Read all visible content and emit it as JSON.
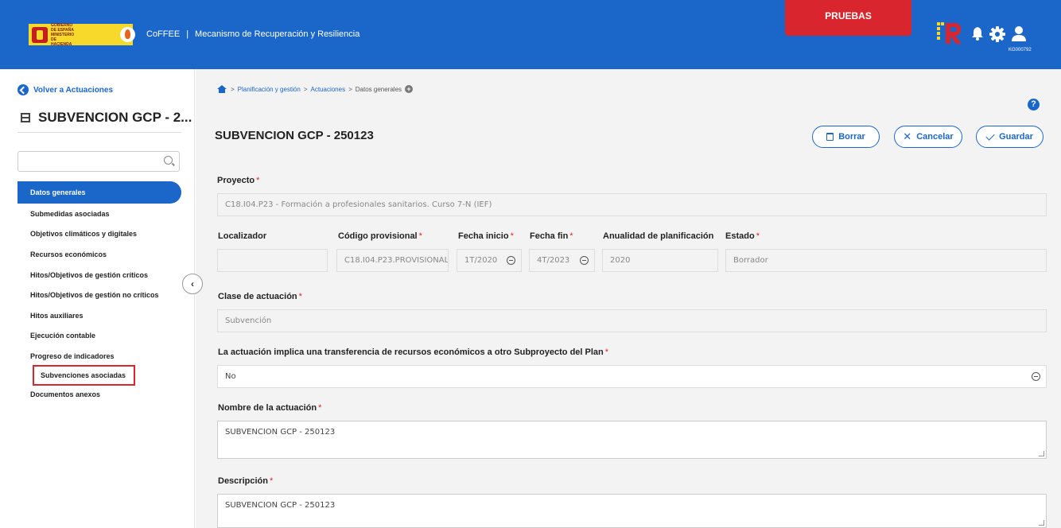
{
  "header": {
    "gov_logo_text": "GOBIERNO DE ESPAÑA MINISTERIO DE HACIENDA",
    "app_name": "CoFFEE",
    "separator": "|",
    "app_subtitle": "Mecanismo de Recuperación y Resiliencia",
    "environment_badge": "PRUEBAS",
    "user_code": "KG000792",
    "colors": {
      "primary": "#1b66c9",
      "badge": "#d9262e"
    }
  },
  "sidebar": {
    "back_label": "Volver a Actuaciones",
    "title": "SUBVENCION GCP - 2...",
    "search_placeholder": "",
    "items": [
      {
        "label": "Datos generales",
        "active": true
      },
      {
        "label": "Submedidas asociadas"
      },
      {
        "label": "Objetivos climáticos y digitales"
      },
      {
        "label": "Recursos económicos"
      },
      {
        "label": "Hitos/Objetivos de gestión críticos"
      },
      {
        "label": "Hitos/Objetivos de gestión no críticos"
      },
      {
        "label": "Hitos auxiliares"
      },
      {
        "label": "Ejecución contable"
      },
      {
        "label": "Progreso de indicadores"
      },
      {
        "label": "Subvenciones asociadas",
        "highlighted": true
      },
      {
        "label": "Documentos anexos"
      }
    ]
  },
  "breadcrumb": {
    "sep": ">",
    "items": [
      "Planificación y gestión",
      "Actuaciones",
      "Datos generales"
    ]
  },
  "page": {
    "title": "SUBVENCION GCP - 250123",
    "buttons": {
      "delete": "Borrar",
      "cancel": "Cancelar",
      "save": "Guardar"
    }
  },
  "form": {
    "required_mark": "*",
    "proyecto": {
      "label": "Proyecto",
      "value": "C18.I04.P23 - Formación a profesionales sanitarios. Curso 7-N (IEF)"
    },
    "localizador": {
      "label": "Localizador",
      "value": ""
    },
    "codigo_provisional": {
      "label": "Código provisional",
      "value": "C18.I04.P23.PROVISIONAL"
    },
    "fecha_inicio": {
      "label": "Fecha inicio",
      "value": "1T/2020"
    },
    "fecha_fin": {
      "label": "Fecha fin",
      "value": "4T/2023"
    },
    "anualidad": {
      "label": "Anualidad de planificación",
      "value": "2020"
    },
    "estado": {
      "label": "Estado",
      "value": "Borrador"
    },
    "clase_actuacion": {
      "label": "Clase de actuación",
      "value": "Subvención"
    },
    "transferencia": {
      "label": "La actuación implica una transferencia de recursos económicos a otro Subproyecto del Plan",
      "value": "No"
    },
    "nombre": {
      "label": "Nombre de la actuación",
      "value": "SUBVENCION GCP - 250123"
    },
    "descripcion": {
      "label": "Descripción",
      "value": "SUBVENCION GCP - 250123"
    }
  }
}
